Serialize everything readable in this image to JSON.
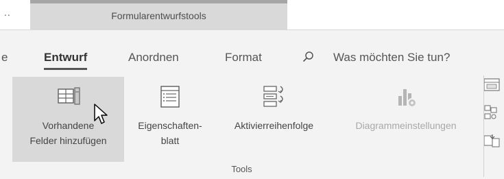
{
  "context_strip": {
    "ellipsis": "..",
    "context_tab": "Formularentwurfstools"
  },
  "tabs": [
    {
      "label": "e",
      "active": false
    },
    {
      "label": "Entwurf",
      "active": true
    },
    {
      "label": "Anordnen",
      "active": false
    },
    {
      "label": "Format",
      "active": false
    }
  ],
  "search": {
    "icon": "search-icon",
    "label": "Was möchten Sie tun?"
  },
  "ribbon": {
    "buttons": [
      {
        "line1": "Vorhandene",
        "line2": "Felder hinzufügen",
        "icon": "add-fields-icon",
        "hovered": true,
        "enabled": true
      },
      {
        "line1": "Eigenschaften-",
        "line2": "blatt",
        "icon": "property-sheet-icon",
        "enabled": true
      },
      {
        "line1": "Aktivierreihenfolge",
        "line2": "",
        "icon": "tab-order-icon",
        "enabled": true
      },
      {
        "line1": "Diagrammeinstellungen",
        "line2": "",
        "icon": "chart-settings-icon",
        "enabled": false
      }
    ],
    "group_label": "Tools",
    "side_icons": [
      "subform-icon",
      "relationships-icon",
      "convert-icon"
    ]
  }
}
